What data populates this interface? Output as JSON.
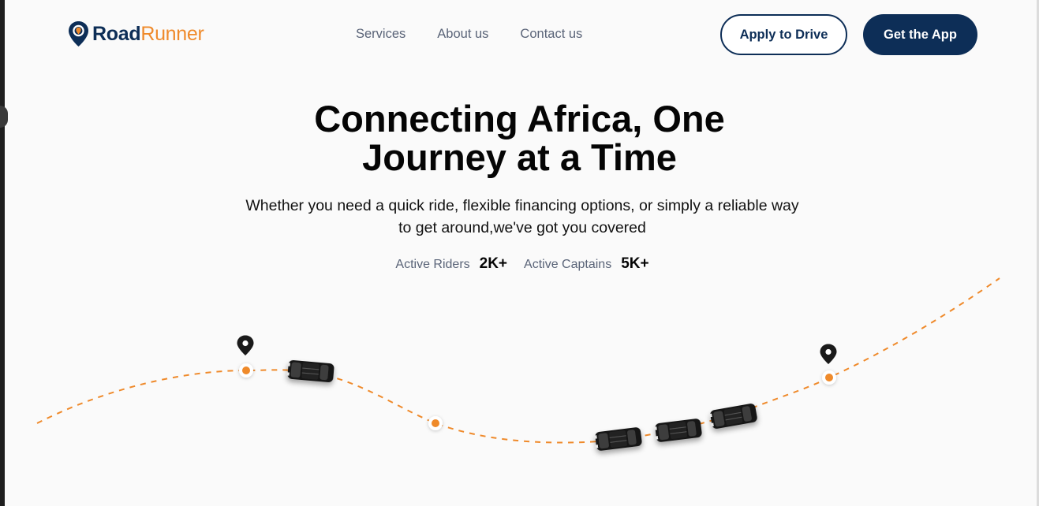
{
  "brand": {
    "name_part1": "Road",
    "name_part2": "Runner",
    "primary_color": "#0d2e57",
    "accent_color": "#ef8a2b",
    "logo_icon": "map-pin-icon"
  },
  "nav": {
    "items": [
      {
        "label": "Services"
      },
      {
        "label": "About us"
      },
      {
        "label": "Contact us"
      }
    ]
  },
  "actions": {
    "apply_label": "Apply to Drive",
    "get_app_label": "Get the App"
  },
  "hero": {
    "title_line1": "Connecting Africa, One",
    "title_line2": "Journey at a Time",
    "subtitle_line1": "Whether you need a quick ride, flexible financing options, or simply a reliable way",
    "subtitle_line2": "to get around,we've got you covered"
  },
  "stats": [
    {
      "label": "Active Riders",
      "value": "2K+"
    },
    {
      "label": "Active Captains",
      "value": "5K+"
    }
  ],
  "illustration": {
    "route_color": "#ef8a2b",
    "pin_icon": "location-pin-icon",
    "vehicle_icon": "car-icon"
  }
}
